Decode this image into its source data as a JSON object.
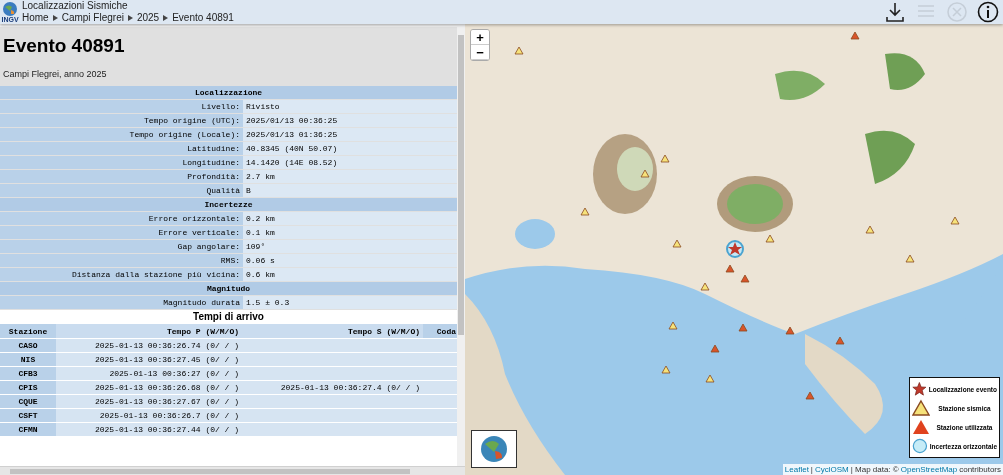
{
  "header": {
    "logo_text": "INGV",
    "title": "Localizzazioni Sismiche",
    "breadcrumb": [
      "Home",
      "Campi Flegrei",
      "2025",
      "Evento 40891"
    ]
  },
  "toolbar": [
    {
      "kind": "download",
      "disabled": false
    },
    {
      "kind": "list",
      "disabled": true
    },
    {
      "kind": "close",
      "disabled": true
    },
    {
      "kind": "info",
      "disabled": false
    }
  ],
  "event": {
    "title": "Evento 40891",
    "subtitle": "Campi Flegrei, anno 2025"
  },
  "details": [
    {
      "title": "Localizzazione",
      "rows": [
        {
          "label": "Livello:",
          "value": "Rivisto"
        },
        {
          "label": "Tempo origine (UTC):",
          "value": "2025/01/13 00:36:25"
        },
        {
          "label": "Tempo origine (Locale):",
          "value": "2025/01/13 01:36:25"
        },
        {
          "label": "Latitudine:",
          "value": "40.8345 (40N 50.07)"
        },
        {
          "label": "Longitudine:",
          "value": "14.1420 (14E 08.52)"
        },
        {
          "label": "Profondità:",
          "value": "2.7 km"
        },
        {
          "label": "Qualità",
          "value": "B"
        }
      ]
    },
    {
      "title": "Incertezze",
      "rows": [
        {
          "label": "Errore orizzontale:",
          "value": "0.2 km"
        },
        {
          "label": "Errore verticale:",
          "value": "0.1 km"
        },
        {
          "label": "Gap angolare:",
          "value": "109°"
        },
        {
          "label": "RMS:",
          "value": "0.06 s"
        },
        {
          "label": "Distanza dalla stazione più vicina:",
          "value": "0.6 km"
        }
      ]
    },
    {
      "title": "Magnitudo",
      "rows": [
        {
          "label": "Magnitudo durata",
          "value": "1.5 ± 0.3"
        }
      ]
    }
  ],
  "arrivals": {
    "title": "Tempi di arrivo",
    "columns": [
      "Stazione",
      "Tempo P (W/M/O)",
      "Tempo S (W/M/O)",
      "Coda"
    ],
    "rows": [
      {
        "station": "CASO",
        "p": "2025-01-13 00:36:26.74 (0/ / )"
      },
      {
        "station": "NIS",
        "p": "2025-01-13 00:36:27.45 (0/ / )"
      },
      {
        "station": "CFB3",
        "p": "2025-01-13 00:36:27 (0/ / )"
      },
      {
        "station": "CPIS",
        "p": "2025-01-13 00:36:26.68 (0/ / )",
        "s": "2025-01-13 00:36:27.4 (0/ / )"
      },
      {
        "station": "CQUE",
        "p": "2025-01-13 00:36:27.67 (0/ / )"
      },
      {
        "station": "CSFT",
        "p": "2025-01-13 00:36:26.7 (0/ / )"
      },
      {
        "station": "CFMN",
        "p": "2025-01-13 00:36:27.44 (0/ / )"
      }
    ]
  },
  "map": {
    "zoom_in": "+",
    "zoom_out": "−",
    "legend": [
      {
        "kind": "event",
        "label": "Localizzazione evento"
      },
      {
        "kind": "seismic",
        "label": "Stazione sismica"
      },
      {
        "kind": "used",
        "label": "Stazione utilizzata"
      },
      {
        "kind": "uncertainty",
        "label": "Incertezza orizzontale"
      }
    ],
    "attribution": [
      {
        "kind": "link",
        "text": "Leaflet"
      },
      {
        "kind": "text",
        "text": "|"
      },
      {
        "kind": "link",
        "text": "CyclOSM"
      },
      {
        "kind": "text",
        "text": "| Map data: ©"
      },
      {
        "kind": "link",
        "text": "OpenStreetMap"
      },
      {
        "kind": "text",
        "text": "contributors"
      }
    ]
  }
}
